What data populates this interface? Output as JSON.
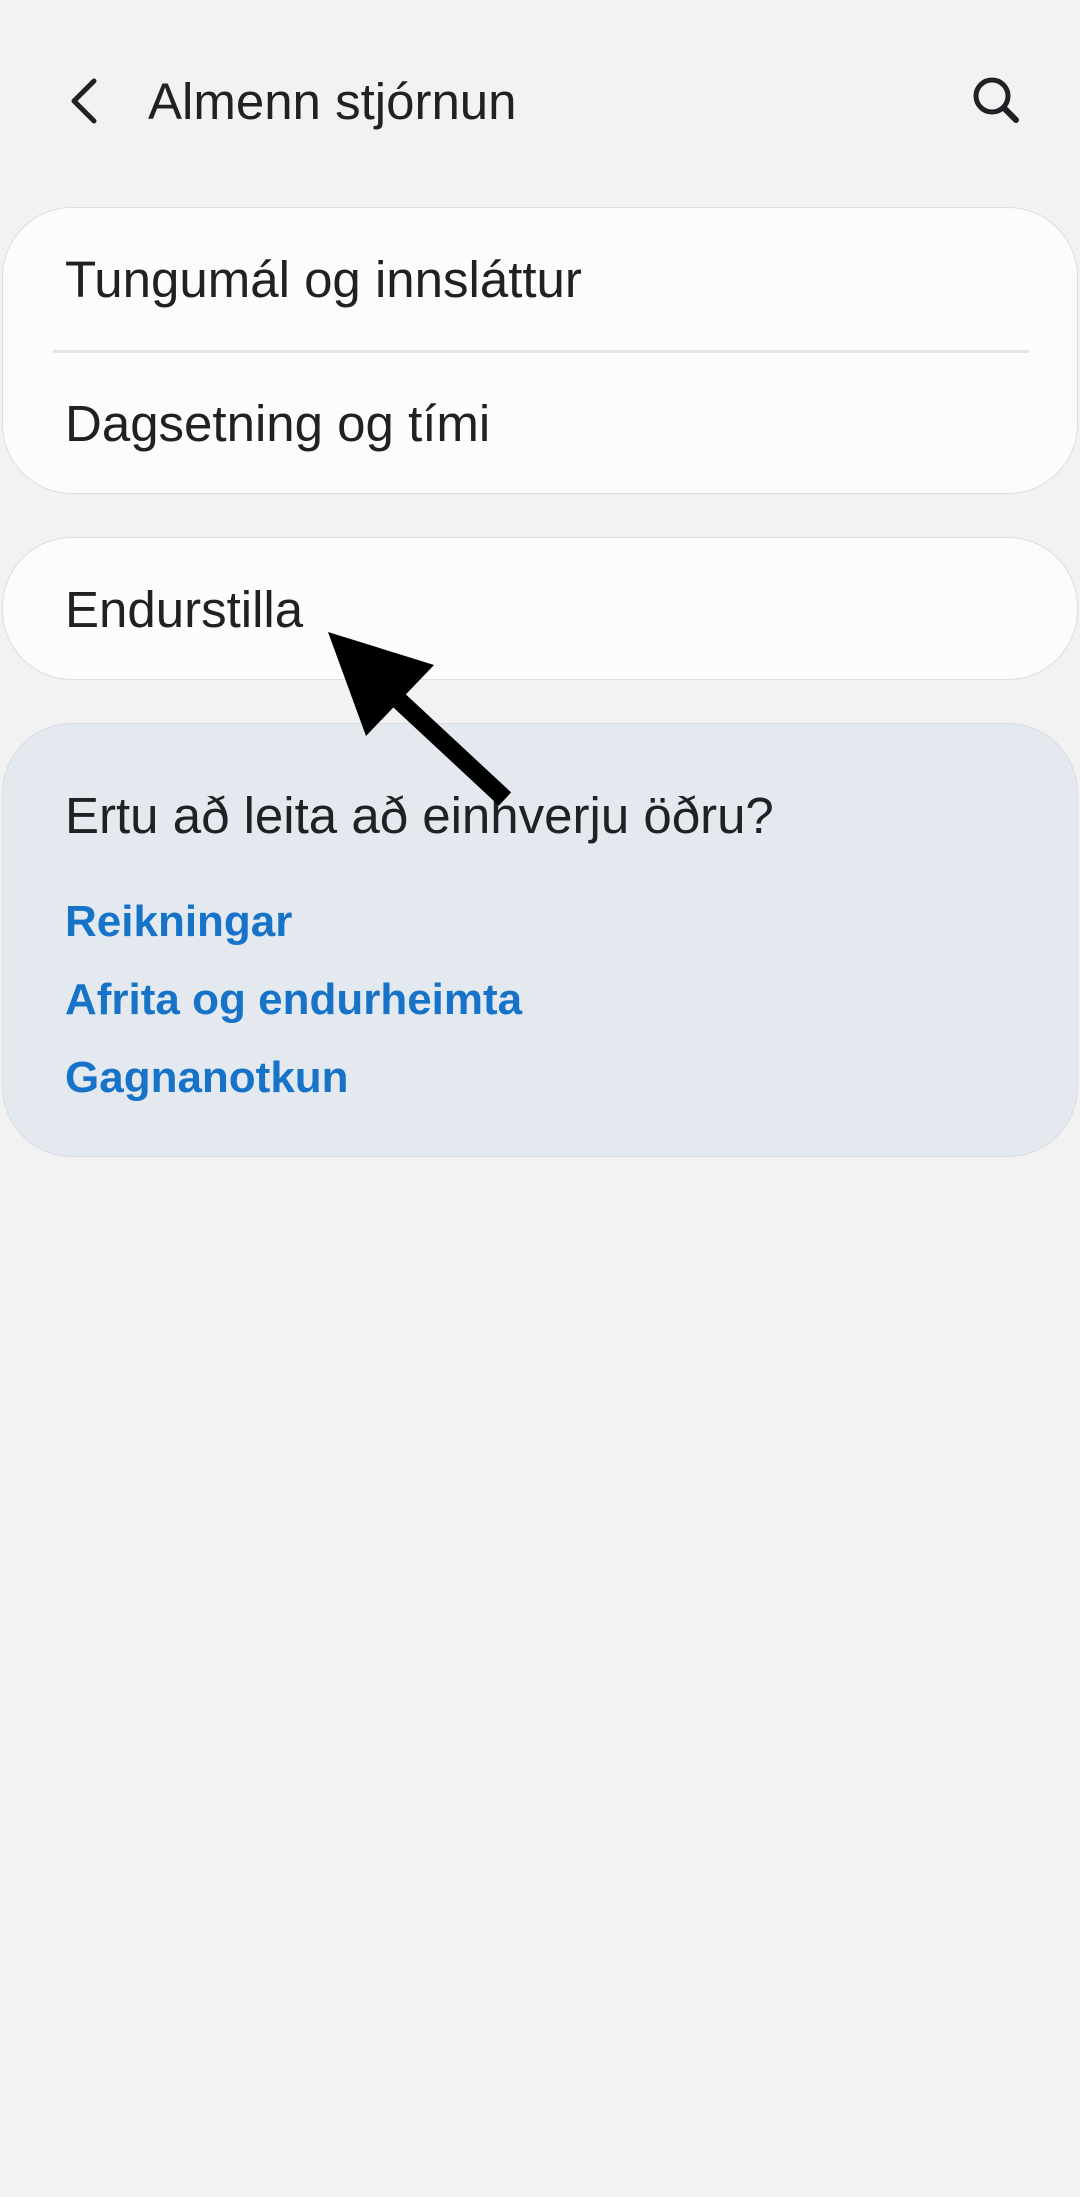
{
  "header": {
    "title": "Almenn stjórnun",
    "back_icon": "chevron-left-icon",
    "search_icon": "search-icon"
  },
  "settings_group": {
    "items": [
      {
        "label": "Tungumál og innsláttur"
      },
      {
        "label": "Dagsetning og tími"
      }
    ]
  },
  "reset_group": {
    "label": "Endurstilla"
  },
  "suggestions": {
    "title": "Ertu að leita að einhverju öðru?",
    "links": [
      {
        "label": "Reikningar"
      },
      {
        "label": "Afrita og endurheimta"
      },
      {
        "label": "Gagnanotkun"
      }
    ],
    "link_color": "#1673c8"
  },
  "annotation": {
    "pointer_icon": "arrow-pointer-icon",
    "color": "#000000"
  },
  "colors": {
    "background": "#f2f2f2",
    "card": "#fcfcfc",
    "suggest_card": "#e3e9ef",
    "text": "#202124"
  }
}
